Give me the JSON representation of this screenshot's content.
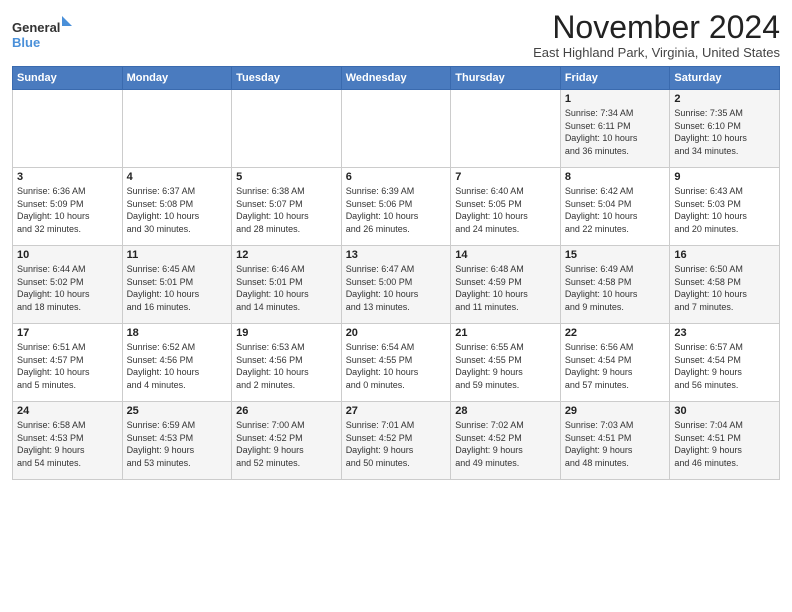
{
  "logo": {
    "line1": "General",
    "line2": "Blue"
  },
  "header": {
    "month": "November 2024",
    "location": "East Highland Park, Virginia, United States"
  },
  "weekdays": [
    "Sunday",
    "Monday",
    "Tuesday",
    "Wednesday",
    "Thursday",
    "Friday",
    "Saturday"
  ],
  "weeks": [
    [
      {
        "day": "",
        "info": ""
      },
      {
        "day": "",
        "info": ""
      },
      {
        "day": "",
        "info": ""
      },
      {
        "day": "",
        "info": ""
      },
      {
        "day": "",
        "info": ""
      },
      {
        "day": "1",
        "info": "Sunrise: 7:34 AM\nSunset: 6:11 PM\nDaylight: 10 hours\nand 36 minutes."
      },
      {
        "day": "2",
        "info": "Sunrise: 7:35 AM\nSunset: 6:10 PM\nDaylight: 10 hours\nand 34 minutes."
      }
    ],
    [
      {
        "day": "3",
        "info": "Sunrise: 6:36 AM\nSunset: 5:09 PM\nDaylight: 10 hours\nand 32 minutes."
      },
      {
        "day": "4",
        "info": "Sunrise: 6:37 AM\nSunset: 5:08 PM\nDaylight: 10 hours\nand 30 minutes."
      },
      {
        "day": "5",
        "info": "Sunrise: 6:38 AM\nSunset: 5:07 PM\nDaylight: 10 hours\nand 28 minutes."
      },
      {
        "day": "6",
        "info": "Sunrise: 6:39 AM\nSunset: 5:06 PM\nDaylight: 10 hours\nand 26 minutes."
      },
      {
        "day": "7",
        "info": "Sunrise: 6:40 AM\nSunset: 5:05 PM\nDaylight: 10 hours\nand 24 minutes."
      },
      {
        "day": "8",
        "info": "Sunrise: 6:42 AM\nSunset: 5:04 PM\nDaylight: 10 hours\nand 22 minutes."
      },
      {
        "day": "9",
        "info": "Sunrise: 6:43 AM\nSunset: 5:03 PM\nDaylight: 10 hours\nand 20 minutes."
      }
    ],
    [
      {
        "day": "10",
        "info": "Sunrise: 6:44 AM\nSunset: 5:02 PM\nDaylight: 10 hours\nand 18 minutes."
      },
      {
        "day": "11",
        "info": "Sunrise: 6:45 AM\nSunset: 5:01 PM\nDaylight: 10 hours\nand 16 minutes."
      },
      {
        "day": "12",
        "info": "Sunrise: 6:46 AM\nSunset: 5:01 PM\nDaylight: 10 hours\nand 14 minutes."
      },
      {
        "day": "13",
        "info": "Sunrise: 6:47 AM\nSunset: 5:00 PM\nDaylight: 10 hours\nand 13 minutes."
      },
      {
        "day": "14",
        "info": "Sunrise: 6:48 AM\nSunset: 4:59 PM\nDaylight: 10 hours\nand 11 minutes."
      },
      {
        "day": "15",
        "info": "Sunrise: 6:49 AM\nSunset: 4:58 PM\nDaylight: 10 hours\nand 9 minutes."
      },
      {
        "day": "16",
        "info": "Sunrise: 6:50 AM\nSunset: 4:58 PM\nDaylight: 10 hours\nand 7 minutes."
      }
    ],
    [
      {
        "day": "17",
        "info": "Sunrise: 6:51 AM\nSunset: 4:57 PM\nDaylight: 10 hours\nand 5 minutes."
      },
      {
        "day": "18",
        "info": "Sunrise: 6:52 AM\nSunset: 4:56 PM\nDaylight: 10 hours\nand 4 minutes."
      },
      {
        "day": "19",
        "info": "Sunrise: 6:53 AM\nSunset: 4:56 PM\nDaylight: 10 hours\nand 2 minutes."
      },
      {
        "day": "20",
        "info": "Sunrise: 6:54 AM\nSunset: 4:55 PM\nDaylight: 10 hours\nand 0 minutes."
      },
      {
        "day": "21",
        "info": "Sunrise: 6:55 AM\nSunset: 4:55 PM\nDaylight: 9 hours\nand 59 minutes."
      },
      {
        "day": "22",
        "info": "Sunrise: 6:56 AM\nSunset: 4:54 PM\nDaylight: 9 hours\nand 57 minutes."
      },
      {
        "day": "23",
        "info": "Sunrise: 6:57 AM\nSunset: 4:54 PM\nDaylight: 9 hours\nand 56 minutes."
      }
    ],
    [
      {
        "day": "24",
        "info": "Sunrise: 6:58 AM\nSunset: 4:53 PM\nDaylight: 9 hours\nand 54 minutes."
      },
      {
        "day": "25",
        "info": "Sunrise: 6:59 AM\nSunset: 4:53 PM\nDaylight: 9 hours\nand 53 minutes."
      },
      {
        "day": "26",
        "info": "Sunrise: 7:00 AM\nSunset: 4:52 PM\nDaylight: 9 hours\nand 52 minutes."
      },
      {
        "day": "27",
        "info": "Sunrise: 7:01 AM\nSunset: 4:52 PM\nDaylight: 9 hours\nand 50 minutes."
      },
      {
        "day": "28",
        "info": "Sunrise: 7:02 AM\nSunset: 4:52 PM\nDaylight: 9 hours\nand 49 minutes."
      },
      {
        "day": "29",
        "info": "Sunrise: 7:03 AM\nSunset: 4:51 PM\nDaylight: 9 hours\nand 48 minutes."
      },
      {
        "day": "30",
        "info": "Sunrise: 7:04 AM\nSunset: 4:51 PM\nDaylight: 9 hours\nand 46 minutes."
      }
    ]
  ]
}
